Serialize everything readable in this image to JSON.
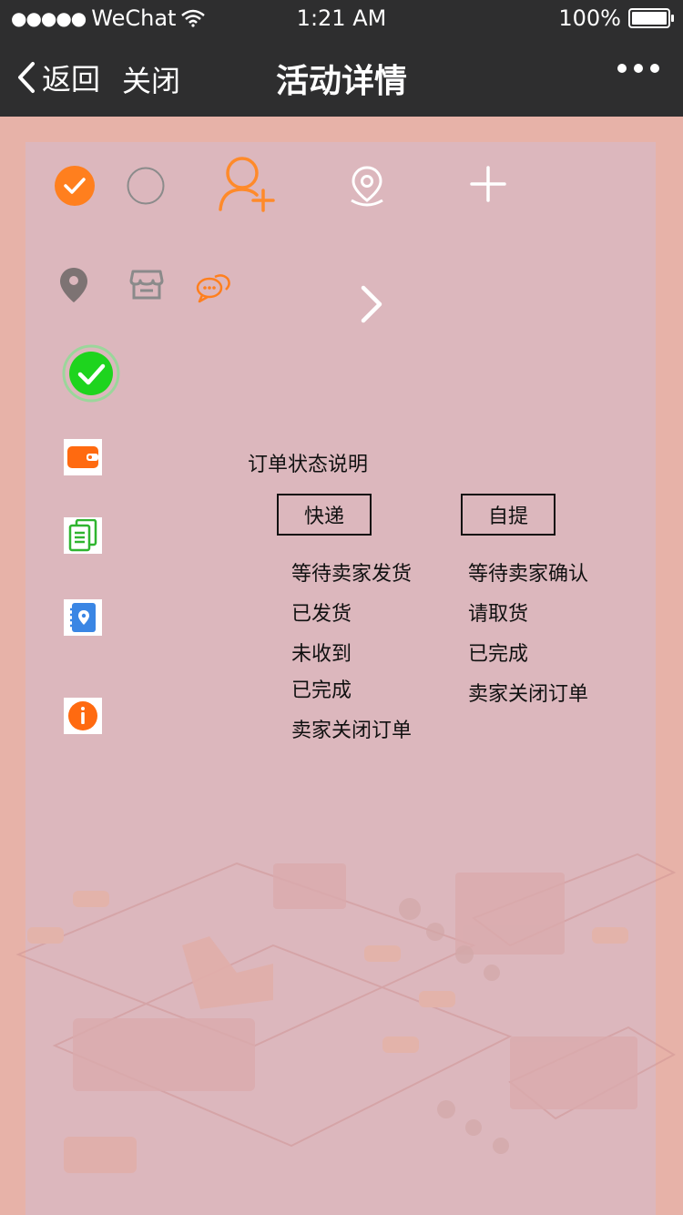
{
  "status_bar": {
    "carrier": "WeChat",
    "time": "1:21 AM",
    "battery": "100%"
  },
  "nav": {
    "back_label": "返回",
    "close_label": "关闭",
    "title": "活动详情"
  },
  "order_status": {
    "title": "订单状态说明",
    "tabs": [
      {
        "label": "快递"
      },
      {
        "label": "自提"
      }
    ],
    "express_statuses": [
      "等待卖家发货",
      "已发货",
      "未收到",
      "已完成",
      "卖家关闭订单"
    ],
    "pickup_statuses": [
      "等待卖家确认",
      "请取货",
      "已完成",
      "卖家关闭订单"
    ]
  },
  "colors": {
    "nav_bg": "#2e2e2f",
    "accent_orange": "#ff7f1e",
    "success_green": "#1ed41e",
    "page_bg": "#e7b2a8",
    "panel_bg": "#dcb7bd"
  },
  "icons": {
    "row1": [
      "checked-circle-icon",
      "unchecked-circle-icon",
      "add-user-icon",
      "location-pin-outline-icon",
      "plus-icon"
    ],
    "row2": [
      "location-pin-icon",
      "store-icon",
      "chat-bubbles-icon",
      "chevron-right-icon"
    ],
    "list": [
      "success-check-icon",
      "wallet-icon",
      "documents-icon",
      "address-book-icon",
      "info-icon"
    ]
  }
}
